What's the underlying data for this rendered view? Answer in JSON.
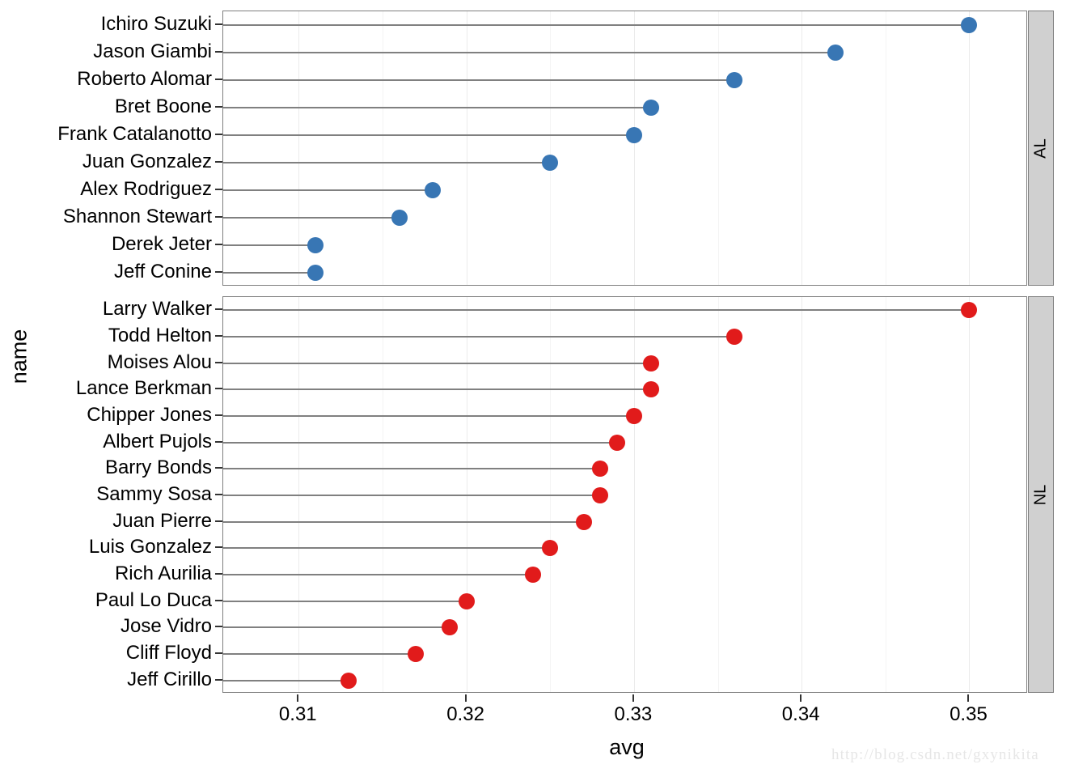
{
  "chart_data": {
    "type": "scatter",
    "subtype": "lollipop-dotplot",
    "title": "",
    "xlabel": "avg",
    "ylabel": "name",
    "xlim": [
      0.3055,
      0.3535
    ],
    "xticks": [
      0.31,
      0.32,
      0.33,
      0.34,
      0.35
    ],
    "xticklabels": [
      "0.31",
      "0.32",
      "0.33",
      "0.34",
      "0.35"
    ],
    "minor_xticks": [
      0.315,
      0.325,
      0.335,
      0.345
    ],
    "grid": true,
    "legend": null,
    "facet_variable": "lg",
    "facet_position": "right",
    "panels": [
      {
        "label": "AL",
        "color": "#3876B4",
        "categories": [
          "Ichiro Suzuki",
          "Jason Giambi",
          "Roberto Alomar",
          "Bret Boone",
          "Frank Catalanotto",
          "Juan Gonzalez",
          "Alex Rodriguez",
          "Shannon Stewart",
          "Derek Jeter",
          "Jeff Conine"
        ],
        "values": [
          0.35,
          0.342,
          0.336,
          0.331,
          0.33,
          0.325,
          0.318,
          0.316,
          0.311,
          0.311
        ]
      },
      {
        "label": "NL",
        "color": "#E11B1B",
        "categories": [
          "Larry Walker",
          "Todd Helton",
          "Moises Alou",
          "Lance Berkman",
          "Chipper Jones",
          "Albert Pujols",
          "Barry Bonds",
          "Sammy Sosa",
          "Juan Pierre",
          "Luis Gonzalez",
          "Rich Aurilia",
          "Paul Lo Duca",
          "Jose Vidro",
          "Cliff Floyd",
          "Jeff Cirillo"
        ],
        "values": [
          0.35,
          0.336,
          0.331,
          0.331,
          0.33,
          0.329,
          0.328,
          0.328,
          0.327,
          0.325,
          0.324,
          0.32,
          0.319,
          0.317,
          0.313
        ]
      }
    ]
  },
  "axes": {
    "x_title": "avg",
    "y_title": "name"
  },
  "strips": {
    "al": "AL",
    "nl": "NL"
  },
  "watermark": {
    "text": "http://blog.csdn.net/gxynikita"
  },
  "colors": {
    "al_point": "#3876B4",
    "nl_point": "#E11B1B",
    "stem": "#808080",
    "panel_border": "#7f7f7f",
    "strip_fill": "#d0d0d0",
    "grid_major": "#ebebeb",
    "grid_minor": "#f4f4f4",
    "background": "#ffffff"
  }
}
